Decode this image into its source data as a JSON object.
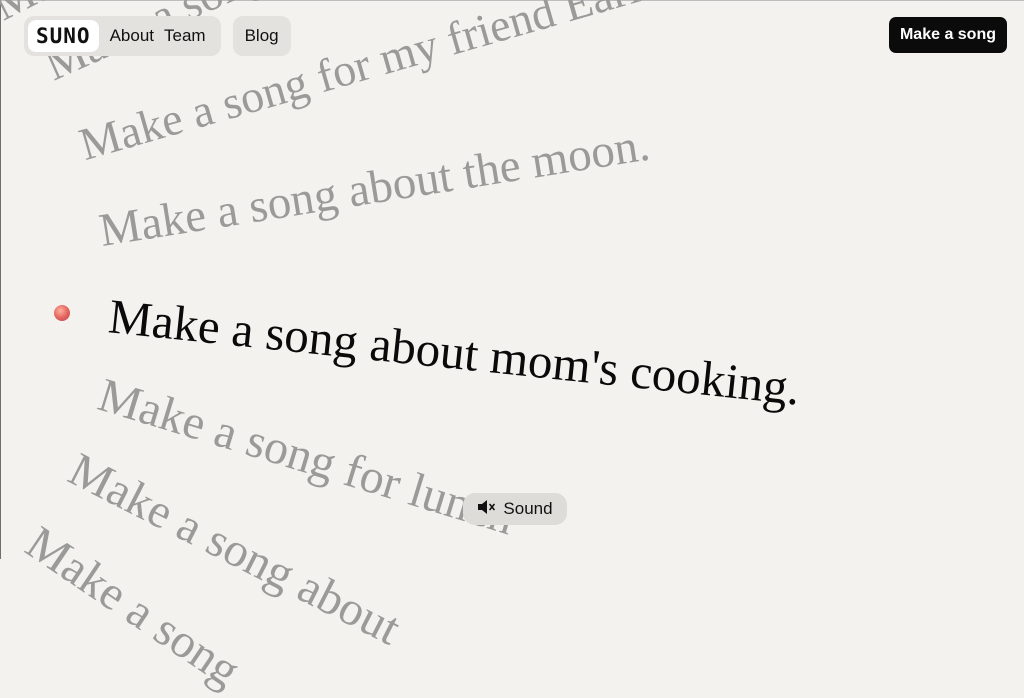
{
  "nav": {
    "logo": "SUNO",
    "links": [
      "About",
      "Team",
      "Blog"
    ]
  },
  "cta_label": "Make a song",
  "prompts": [
    "Make a song",
    "Make a song for my friend Earl.",
    "Make a song for my friend Earl.",
    "Make a song about the moon.",
    "Make a song about mom's cooking.",
    "Make a song for lunch",
    "Make a song about",
    "Make a song"
  ],
  "sound_label": "Sound",
  "icons": {
    "mute": "speaker-muted-icon"
  },
  "colors": {
    "background": "#f3f2ef",
    "faded_text": "#9a9a98",
    "active_text": "#0a0a0a",
    "cta": "#0b0b0b"
  }
}
